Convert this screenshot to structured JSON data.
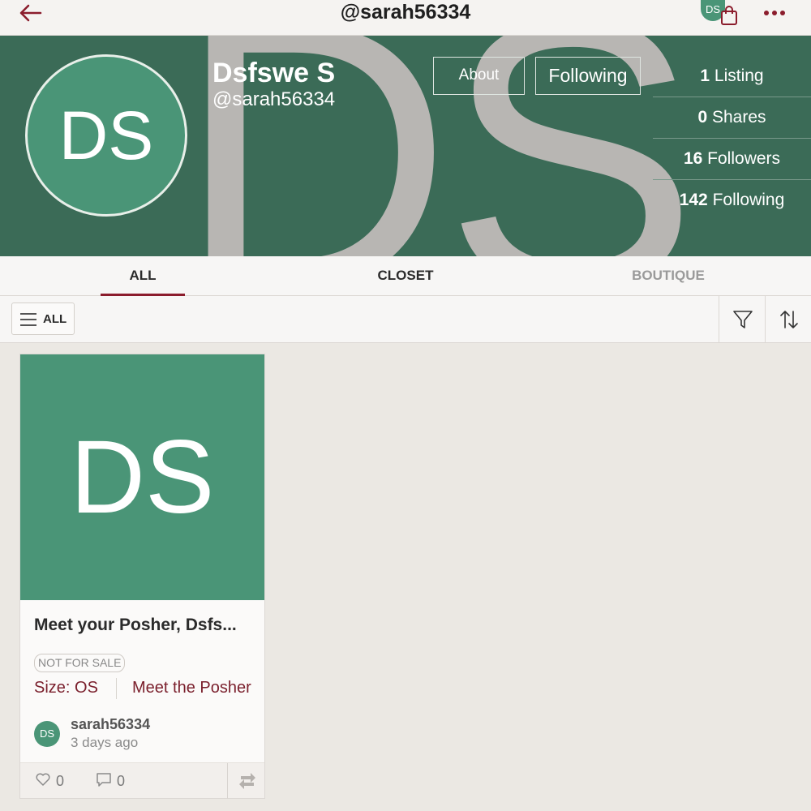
{
  "topbar": {
    "title": "@sarah56334",
    "avatar_initials": "DS"
  },
  "profile": {
    "cover_initials": "DS",
    "avatar_initials": "DS",
    "display_name": "Dsfswe S",
    "handle": "@sarah56334",
    "about_label": "About",
    "following_button_label": "Following",
    "stats": [
      {
        "count": "1",
        "label": "Listing"
      },
      {
        "count": "0",
        "label": "Shares"
      },
      {
        "count": "16",
        "label": "Followers"
      },
      {
        "count": "142",
        "label": "Following"
      }
    ]
  },
  "tabs": [
    {
      "label": "ALL",
      "active": true
    },
    {
      "label": "CLOSET",
      "active": false
    },
    {
      "label": "BOUTIQUE",
      "active": false
    }
  ],
  "filterbar": {
    "all_label": "ALL"
  },
  "listing": {
    "image_initials": "DS",
    "title": "Meet your Posher, Dsfs...",
    "badge": "NOT FOR SALE",
    "size": "Size: OS",
    "meet_link": "Meet the Posher",
    "seller_initials": "DS",
    "seller_name": "sarah56334",
    "posted": "3 days ago",
    "likes": "0",
    "comments": "0"
  },
  "colors": {
    "accent": "#8b1c2c",
    "header_green": "#3b6b57",
    "avatar_green": "#4a9577"
  }
}
